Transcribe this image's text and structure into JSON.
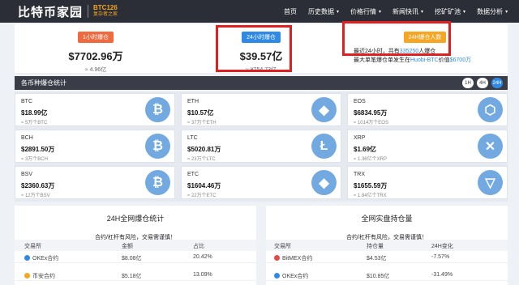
{
  "nav": {
    "logo": "比特币家园",
    "logo_tag": "BTC126",
    "logo_slogan": "复杂者之家",
    "items": [
      {
        "label": "首页",
        "dropdown": false
      },
      {
        "label": "历史数据",
        "dropdown": true
      },
      {
        "label": "价格行情",
        "dropdown": true
      },
      {
        "label": "新闻快讯",
        "dropdown": true
      },
      {
        "label": "挖矿矿池",
        "dropdown": true
      },
      {
        "label": "数据分析",
        "dropdown": true
      }
    ],
    "caret": "▾"
  },
  "summary": {
    "box1": {
      "badge": "1小时爆仓",
      "value": "$7702.96万",
      "sub": "≈ 4.96亿",
      "badge_color": "#f06a40"
    },
    "box2": {
      "badge": "24小时爆仓",
      "value": "$39.57亿",
      "sub": "≈ ¥254.73亿",
      "badge_color": "#2f8ae6"
    },
    "box3": {
      "badge": "24H爆仓人数",
      "badge_color": "#f5a623",
      "line1_pre": "最近24小时，共有",
      "line1_num": "335250",
      "line1_post": "人爆仓",
      "line2_pre": "最大单笔爆仓单发生在",
      "line2_link": "Huobi-BTC",
      "line2_mid": "价值",
      "line2_val": "$6700万"
    }
  },
  "stats": {
    "title": "各币种爆仓统计",
    "periods": [
      "1H",
      "4H",
      "24H"
    ],
    "active_period": "24H"
  },
  "coins": [
    {
      "name": "BTC",
      "value": "$18.99亿",
      "sub": "≈ 5万个BTC",
      "icon": "bitcoin-icon",
      "glyph": "₿"
    },
    {
      "name": "ETH",
      "value": "$10.57亿",
      "sub": "≈ 37万个ETH",
      "icon": "ethereum-icon",
      "glyph": "◆"
    },
    {
      "name": "EOS",
      "value": "$6834.95万",
      "sub": "≈ 1014万个EOS",
      "icon": "eos-icon",
      "glyph": "⬡"
    },
    {
      "name": "BCH",
      "value": "$2891.50万",
      "sub": "≈ 3万个BCH",
      "icon": "bitcoin-cash-icon",
      "glyph": "₿"
    },
    {
      "name": "LTC",
      "value": "$5020.81万",
      "sub": "≈ 23万个LTC",
      "icon": "litecoin-icon",
      "glyph": "Ł"
    },
    {
      "name": "XRP",
      "value": "$1.69亿",
      "sub": "≈ 1.36亿个XRP",
      "icon": "ripple-icon",
      "glyph": "✕"
    },
    {
      "name": "BSV",
      "value": "$2360.63万",
      "sub": "≈ 12万个BSV",
      "icon": "bsv-icon",
      "glyph": "₿"
    },
    {
      "name": "ETC",
      "value": "$1604.46万",
      "sub": "≈ 22万个ETC",
      "icon": "etc-icon",
      "glyph": "◆"
    },
    {
      "name": "TRX",
      "value": "$1655.59万",
      "sub": "≈ 1.84亿个TRX",
      "icon": "tron-icon",
      "glyph": "▽"
    }
  ],
  "left_table": {
    "title": "24H全网爆仓统计",
    "warning": "合约/杠杆有风险，交易需谨慎！",
    "headers": [
      "交易所",
      "金额",
      "占比"
    ],
    "rows": [
      {
        "exchange": "OKEx合约",
        "amount": "$8.08亿",
        "ratio": "20.42%"
      },
      {
        "exchange": "币安合约",
        "amount": "$5.18亿",
        "ratio": "13.09%"
      }
    ]
  },
  "right_table": {
    "title": "全网实盘持仓量",
    "warning": "合约/杠杆有风险，交易需谨慎！",
    "headers": [
      "交易所",
      "持仓量",
      "24H变化"
    ],
    "rows": [
      {
        "exchange": "BitMEX合约",
        "amount": "$4.53亿",
        "change": "-7.57%"
      },
      {
        "exchange": "OKEx合约",
        "amount": "$10.85亿",
        "change": "-31.49%"
      }
    ]
  }
}
